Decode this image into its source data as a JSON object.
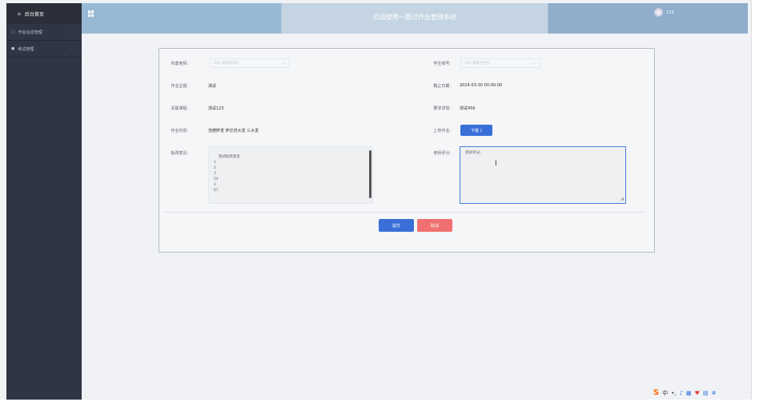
{
  "sidebar": {
    "brand": "后台首页",
    "items": [
      {
        "label": "作业信息管理",
        "icon": "document-icon"
      },
      {
        "label": "考试管理",
        "icon": "pin-icon"
      }
    ]
  },
  "header": {
    "title": "欢迎使用一题过作业管理系统",
    "username": "123"
  },
  "form": {
    "teacher_label": "布置老师:",
    "teacher_value": "123 测试老师1",
    "student_label": "学生账号:",
    "student_value": "123 测试学生1",
    "subject_label": "作业主题:",
    "subject_value": "测试",
    "deadline_label": "截止日期:",
    "deadline_value": "2024-03-30 00:00:00",
    "course_label": "关联课程:",
    "course_value": "测试123",
    "requirement_label": "要求详情:",
    "requirement_value": "测试456",
    "content_label": "作业内容:",
    "content_value": "范德萨发 萨达范大发 三大发",
    "upload_label": "上传作业:",
    "download_button": "下载",
    "download_icon": "download-icon",
    "feedback_label": "批改意见:",
    "feedback_value": "测试批改意见\n1\n2\n3\n54\n3\n67",
    "score_label": "老师评分:",
    "score_value": "测试评分",
    "submit_button": "提交",
    "cancel_button": "取消"
  },
  "colors": {
    "sidebar": "#2f3542",
    "primary": "#3a6fd8",
    "danger": "#f07070"
  }
}
